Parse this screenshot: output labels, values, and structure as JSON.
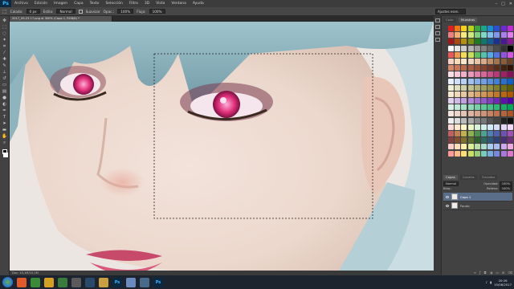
{
  "app": {
    "logo": "Ps",
    "menu": [
      "Archivo",
      "Edición",
      "Imagen",
      "Capa",
      "Texto",
      "Selección",
      "Filtro",
      "3D",
      "Vista",
      "Ventana",
      "Ayuda"
    ],
    "window_controls": [
      "–",
      "□",
      "✕"
    ]
  },
  "options_bar": {
    "feather_label": "Calado:",
    "feather_value": "0 px",
    "mode_label": "Estilo:",
    "mode_value": "Normal",
    "antialias_label": "Suavizar",
    "opacity_label": "Opac.:",
    "opacity_value": "100%",
    "flow_label": "Flujo:",
    "flow_value": "100%",
    "workspace": "Ajustes esen."
  },
  "document": {
    "tab_title": "2017_09-23 17.png al 300% (Capa 1, RGB/8) *",
    "status": "Doc: 10,1M/10,1M"
  },
  "swatches_panel": {
    "tabs": [
      "Color",
      "Muestras"
    ],
    "active_tab": "Muestras",
    "colors": [
      "#e02020",
      "#f07a10",
      "#f4d21a",
      "#b8d41a",
      "#3aa83a",
      "#1aa68c",
      "#1a8cd4",
      "#2a4fd4",
      "#6a2ad4",
      "#c02ad4",
      "#f08080",
      "#f4b070",
      "#f8e880",
      "#d0e880",
      "#80d080",
      "#80d8c8",
      "#80c0ec",
      "#8098ec",
      "#a880ec",
      "#e080ec",
      "#a01818",
      "#a84a10",
      "#b09010",
      "#7a9010",
      "#207820",
      "#107868",
      "#105f94",
      "#1a3094",
      "#4a1a94",
      "#8a1a94",
      "#ffffff",
      "#e6e6e6",
      "#cccccc",
      "#b3b3b3",
      "#999999",
      "#808080",
      "#666666",
      "#4d4d4d",
      "#333333",
      "#000000",
      "#e85a5a",
      "#ef9a50",
      "#f2dd58",
      "#c8df58",
      "#5fbf5f",
      "#55c2ac",
      "#55aae2",
      "#5573e2",
      "#8f55e2",
      "#d355e2",
      "#fbd0c4",
      "#f9d9b8",
      "#f8e6c6",
      "#efd6c0",
      "#e8c3a6",
      "#d8aa88",
      "#c08f6a",
      "#a5744f",
      "#8a5c3a",
      "#6a4428",
      "#d4886a",
      "#c87858",
      "#b86a4c",
      "#a85d42",
      "#965038",
      "#82442e",
      "#6e3824",
      "#5a2c1a",
      "#462010",
      "#321408",
      "#ffe0e8",
      "#f8c8d8",
      "#f0b0c8",
      "#e898b8",
      "#e080a8",
      "#d86898",
      "#c85088",
      "#b83878",
      "#a02068",
      "#881058",
      "#e8f0ff",
      "#d0e0fa",
      "#b8d0f4",
      "#a0c0ee",
      "#88b0e8",
      "#70a0e2",
      "#5890dc",
      "#4080d6",
      "#2870d0",
      "#1060ca",
      "#f0f0d8",
      "#e0e0c0",
      "#d0d0a8",
      "#c0c090",
      "#b0b078",
      "#a0a060",
      "#909048",
      "#808030",
      "#707018",
      "#606000",
      "#f8e8d0",
      "#f0d8b8",
      "#e8c8a0",
      "#e0b888",
      "#d8a870",
      "#d09858",
      "#c88840",
      "#c07828",
      "#b86810",
      "#b05800",
      "#e0d0f0",
      "#d0b8e8",
      "#c0a0e0",
      "#b088d8",
      "#a070d0",
      "#9058c8",
      "#8040c0",
      "#7028b8",
      "#6010b0",
      "#5000a8",
      "#d8f0e8",
      "#c0e8d8",
      "#a8e0c8",
      "#90d8b8",
      "#78d0a8",
      "#60c898",
      "#48c088",
      "#30b878",
      "#18b068",
      "#00a858",
      "#f4e4dc",
      "#ecd4c8",
      "#e4c4b4",
      "#dcb4a0",
      "#d4a48c",
      "#cc9478",
      "#c48464",
      "#bc7450",
      "#b4643c",
      "#ac5428",
      "#eeeeee",
      "#dddddd",
      "#bbbbbb",
      "#aaaaaa",
      "#888888",
      "#777777",
      "#555555",
      "#444444",
      "#222222",
      "#111111",
      "#ffd8d8",
      "#ffe8cc",
      "#fff4c8",
      "#ecf7c8",
      "#d8f2d8",
      "#d0f0ea",
      "#d0e8f8",
      "#d4dcf8",
      "#e4d8f8",
      "#f4d8f8",
      "#c06060",
      "#c08050",
      "#c0b050",
      "#90b050",
      "#509050",
      "#50a090",
      "#5080b0",
      "#5060b0",
      "#7050b0",
      "#a050b0",
      "#804040",
      "#805030",
      "#807030",
      "#607030",
      "#306030",
      "#306860",
      "#305878",
      "#304078",
      "#483078",
      "#703078",
      "#ffcccc",
      "#ffddbb",
      "#ffeeaa",
      "#ddee99",
      "#bbddaa",
      "#aaddcc",
      "#aaccee",
      "#aabbee",
      "#ccaaee",
      "#eeaadd",
      "#ff9999",
      "#ffbb88",
      "#ffdd77",
      "#ccdd66",
      "#99cc77",
      "#77ccbb",
      "#77aadd",
      "#7788dd",
      "#aa77dd",
      "#dd77cc"
    ]
  },
  "layers_panel": {
    "tabs": [
      "Capas",
      "Canales",
      "Trazados"
    ],
    "active_tab": "Capas",
    "blend_mode": "Normal",
    "opacity_label": "Opacidad:",
    "opacity_value": "100%",
    "lock_label": "Bloq.:",
    "fill_label": "Relleno:",
    "fill_value": "100%",
    "layers": [
      {
        "name": "Capa 1",
        "active": true
      },
      {
        "name": "Fondo",
        "active": false
      }
    ],
    "footer_icons": [
      "link-icon",
      "fx-icon",
      "mask-icon",
      "adjust-icon",
      "folder-icon",
      "new-layer-icon",
      "trash-icon"
    ]
  },
  "taskbar": {
    "apps": [
      {
        "name": "browser-icon",
        "label": "",
        "color": "#e05a2a"
      },
      {
        "name": "chrome-icon",
        "label": "",
        "color": "#3a8a3a"
      },
      {
        "name": "explorer-icon",
        "label": "",
        "color": "#d4a020"
      },
      {
        "name": "game-icon",
        "label": "",
        "color": "#3a7a3a"
      },
      {
        "name": "app-icon",
        "label": "",
        "color": "#5a5a5a"
      },
      {
        "name": "steam-icon",
        "label": "",
        "color": "#2a4a6a"
      },
      {
        "name": "folder-icon",
        "label": "",
        "color": "#c8a040"
      },
      {
        "name": "photoshop-icon",
        "label": "Ps",
        "color": "#0a2a44"
      },
      {
        "name": "paint-icon",
        "label": "",
        "color": "#6a8ac0"
      },
      {
        "name": "image-icon",
        "label": "",
        "color": "#4a6a8a"
      },
      {
        "name": "photoshop-icon-2",
        "label": "Ps",
        "color": "#0a2a44"
      }
    ],
    "time": "20:26",
    "date": "15/06/2017"
  }
}
